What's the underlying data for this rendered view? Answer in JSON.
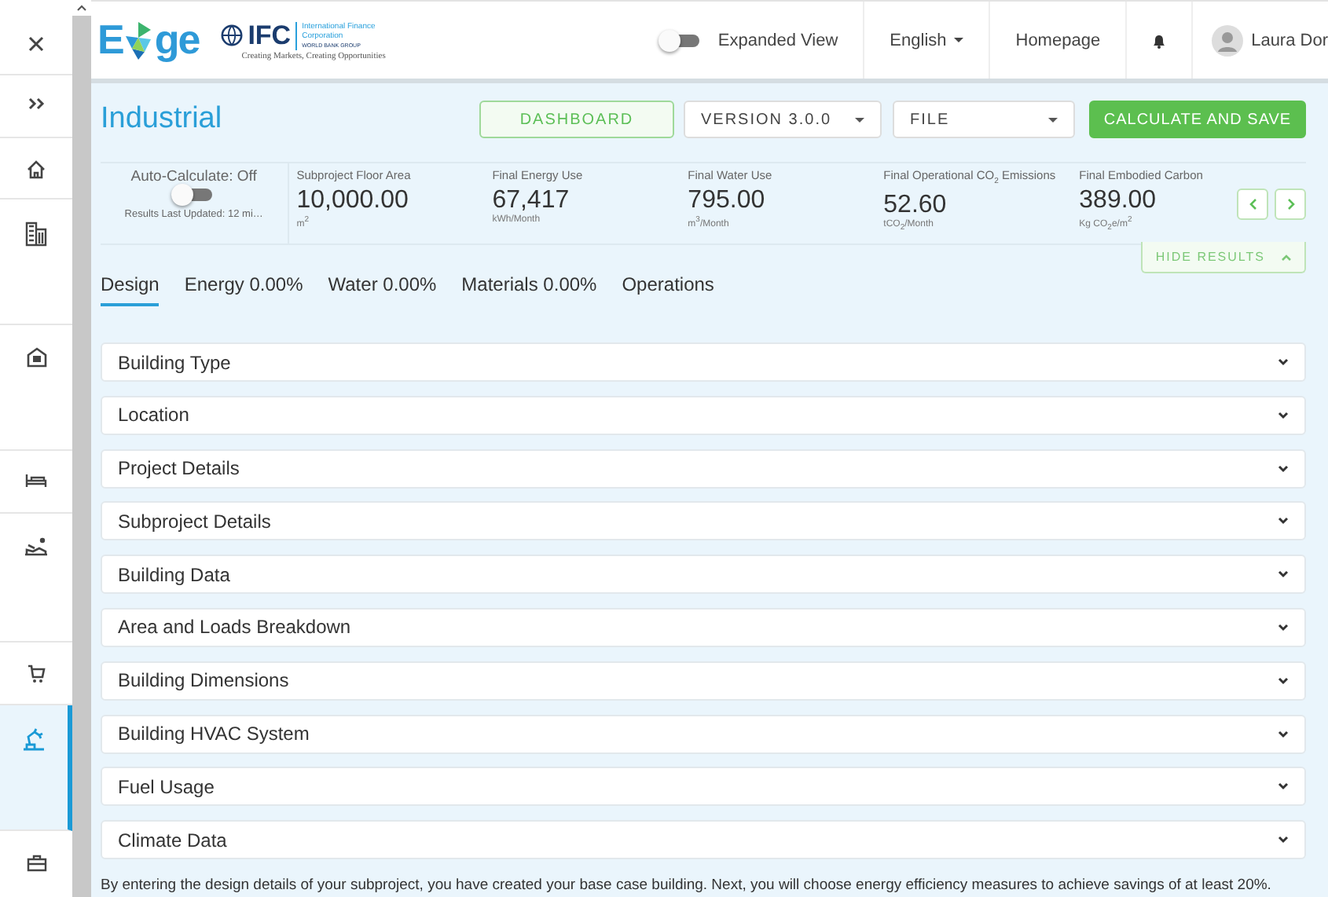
{
  "sidebar": {
    "items": [
      {
        "kind": "close",
        "selected": false
      },
      {
        "kind": "expand",
        "selected": false
      },
      {
        "kind": "home",
        "selected": false
      },
      {
        "kind": "building",
        "selected": false
      },
      {
        "kind": "house",
        "selected": false
      },
      {
        "kind": "bed",
        "selected": false
      },
      {
        "kind": "leisure",
        "selected": false
      },
      {
        "kind": "cart",
        "selected": false
      },
      {
        "kind": "industrial",
        "selected": true
      },
      {
        "kind": "briefcase",
        "selected": false
      }
    ]
  },
  "header": {
    "logo": {
      "start": "E",
      "end": "ge",
      "org": "IFC",
      "org_name": "International Finance Corporation",
      "group": "WORLD BANK GROUP",
      "tagline": "Creating Markets, Creating Opportunities"
    },
    "expanded_view": {
      "label": "Expanded View",
      "on": false
    },
    "language": "English",
    "homepage": "Homepage",
    "user": "Laura Dor"
  },
  "toolbar": {
    "title": "Industrial",
    "dashboard": "DASHBOARD",
    "version": "VERSION 3.0.0",
    "file": "FILE",
    "calculate": "CALCULATE AND SAVE"
  },
  "results": {
    "auto_calculate": {
      "label": "Auto-Calculate: Off",
      "on": false,
      "updated": "Results Last Updated: 12 mi…"
    },
    "metrics": [
      {
        "label": "Subproject Floor Area",
        "value": "10,000.00",
        "unit": "m$^{2}$"
      },
      {
        "label": "Final Energy Use",
        "value": "67,417",
        "unit": "kWh/Month"
      },
      {
        "label": "Final Water Use",
        "value": "795.00",
        "unit": "m$^{3}$/Month"
      },
      {
        "label": "Final Operational CO$_{2}$ Emissions",
        "value": "52.60",
        "unit": "tCO$_{2}$/Month"
      },
      {
        "label": "Final Embodied Carbon",
        "value": "389.00",
        "unit": "Kg CO$_{2}$e/m$^{2}$"
      }
    ],
    "hide": "HIDE RESULTS"
  },
  "tabs": [
    {
      "label": "Design",
      "selected": true
    },
    {
      "label": "Energy 0.00%",
      "selected": false
    },
    {
      "label": "Water 0.00%",
      "selected": false
    },
    {
      "label": "Materials 0.00%",
      "selected": false
    },
    {
      "label": "Operations",
      "selected": false
    }
  ],
  "sections": [
    {
      "title": "Building Type",
      "expanded": false
    },
    {
      "title": "Location",
      "expanded": false
    },
    {
      "title": "Project Details",
      "expanded": false
    },
    {
      "title": "Subproject Details",
      "expanded": false
    },
    {
      "title": "Building Data",
      "expanded": false
    },
    {
      "title": "Area and Loads Breakdown",
      "expanded": false
    },
    {
      "title": "Building Dimensions",
      "expanded": false
    },
    {
      "title": "Building HVAC System",
      "expanded": false
    },
    {
      "title": "Fuel Usage",
      "expanded": false
    },
    {
      "title": "Climate Data",
      "expanded": false
    }
  ],
  "note": "By entering the design details of your subproject, you have created your base case building. Next, you will choose energy efficiency measures to achieve savings of at least 20%."
}
